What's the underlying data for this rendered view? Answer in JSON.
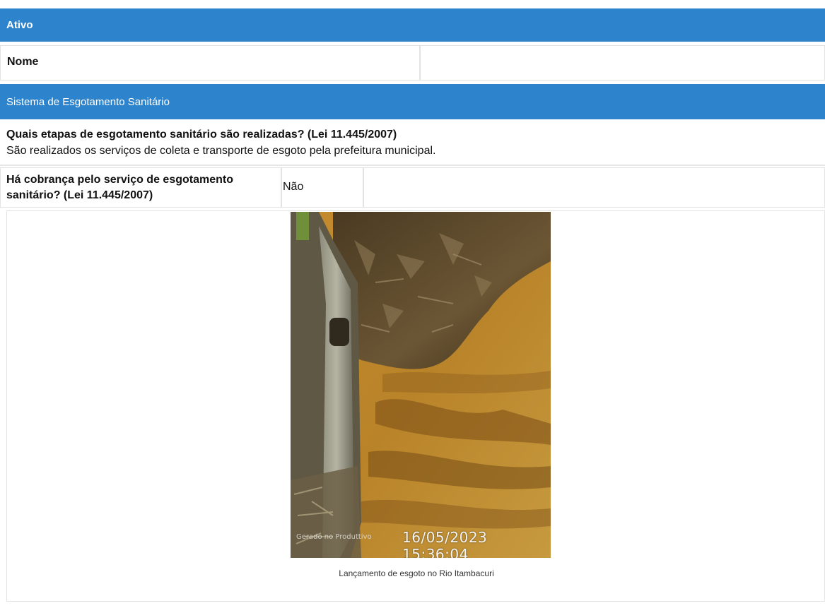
{
  "sections": {
    "ativo_title": "Ativo",
    "sistema_title": "Sistema de Esgotamento Sanitário"
  },
  "ativo": {
    "nome_label": "Nome",
    "nome_value": ""
  },
  "sistema": {
    "q1": {
      "question": "Quais etapas de esgotamento sanitário são realizadas? (Lei 11.445/2007)",
      "answer": "São realizados os serviços de coleta e transporte de esgoto pela prefeitura municipal."
    },
    "q2": {
      "question": "Há cobrança pelo serviço de esgotamento sanitário? (Lei 11.445/2007)",
      "answer": "Não"
    },
    "photo": {
      "timestamp": "16/05/2023 15:36:04",
      "watermark": "Gerado no Produttivo",
      "caption": "Lançamento de esgoto no Rio Itambacuri"
    }
  },
  "colors": {
    "header_blue": "#2e84cc",
    "border_gray": "#e2e2e2"
  }
}
